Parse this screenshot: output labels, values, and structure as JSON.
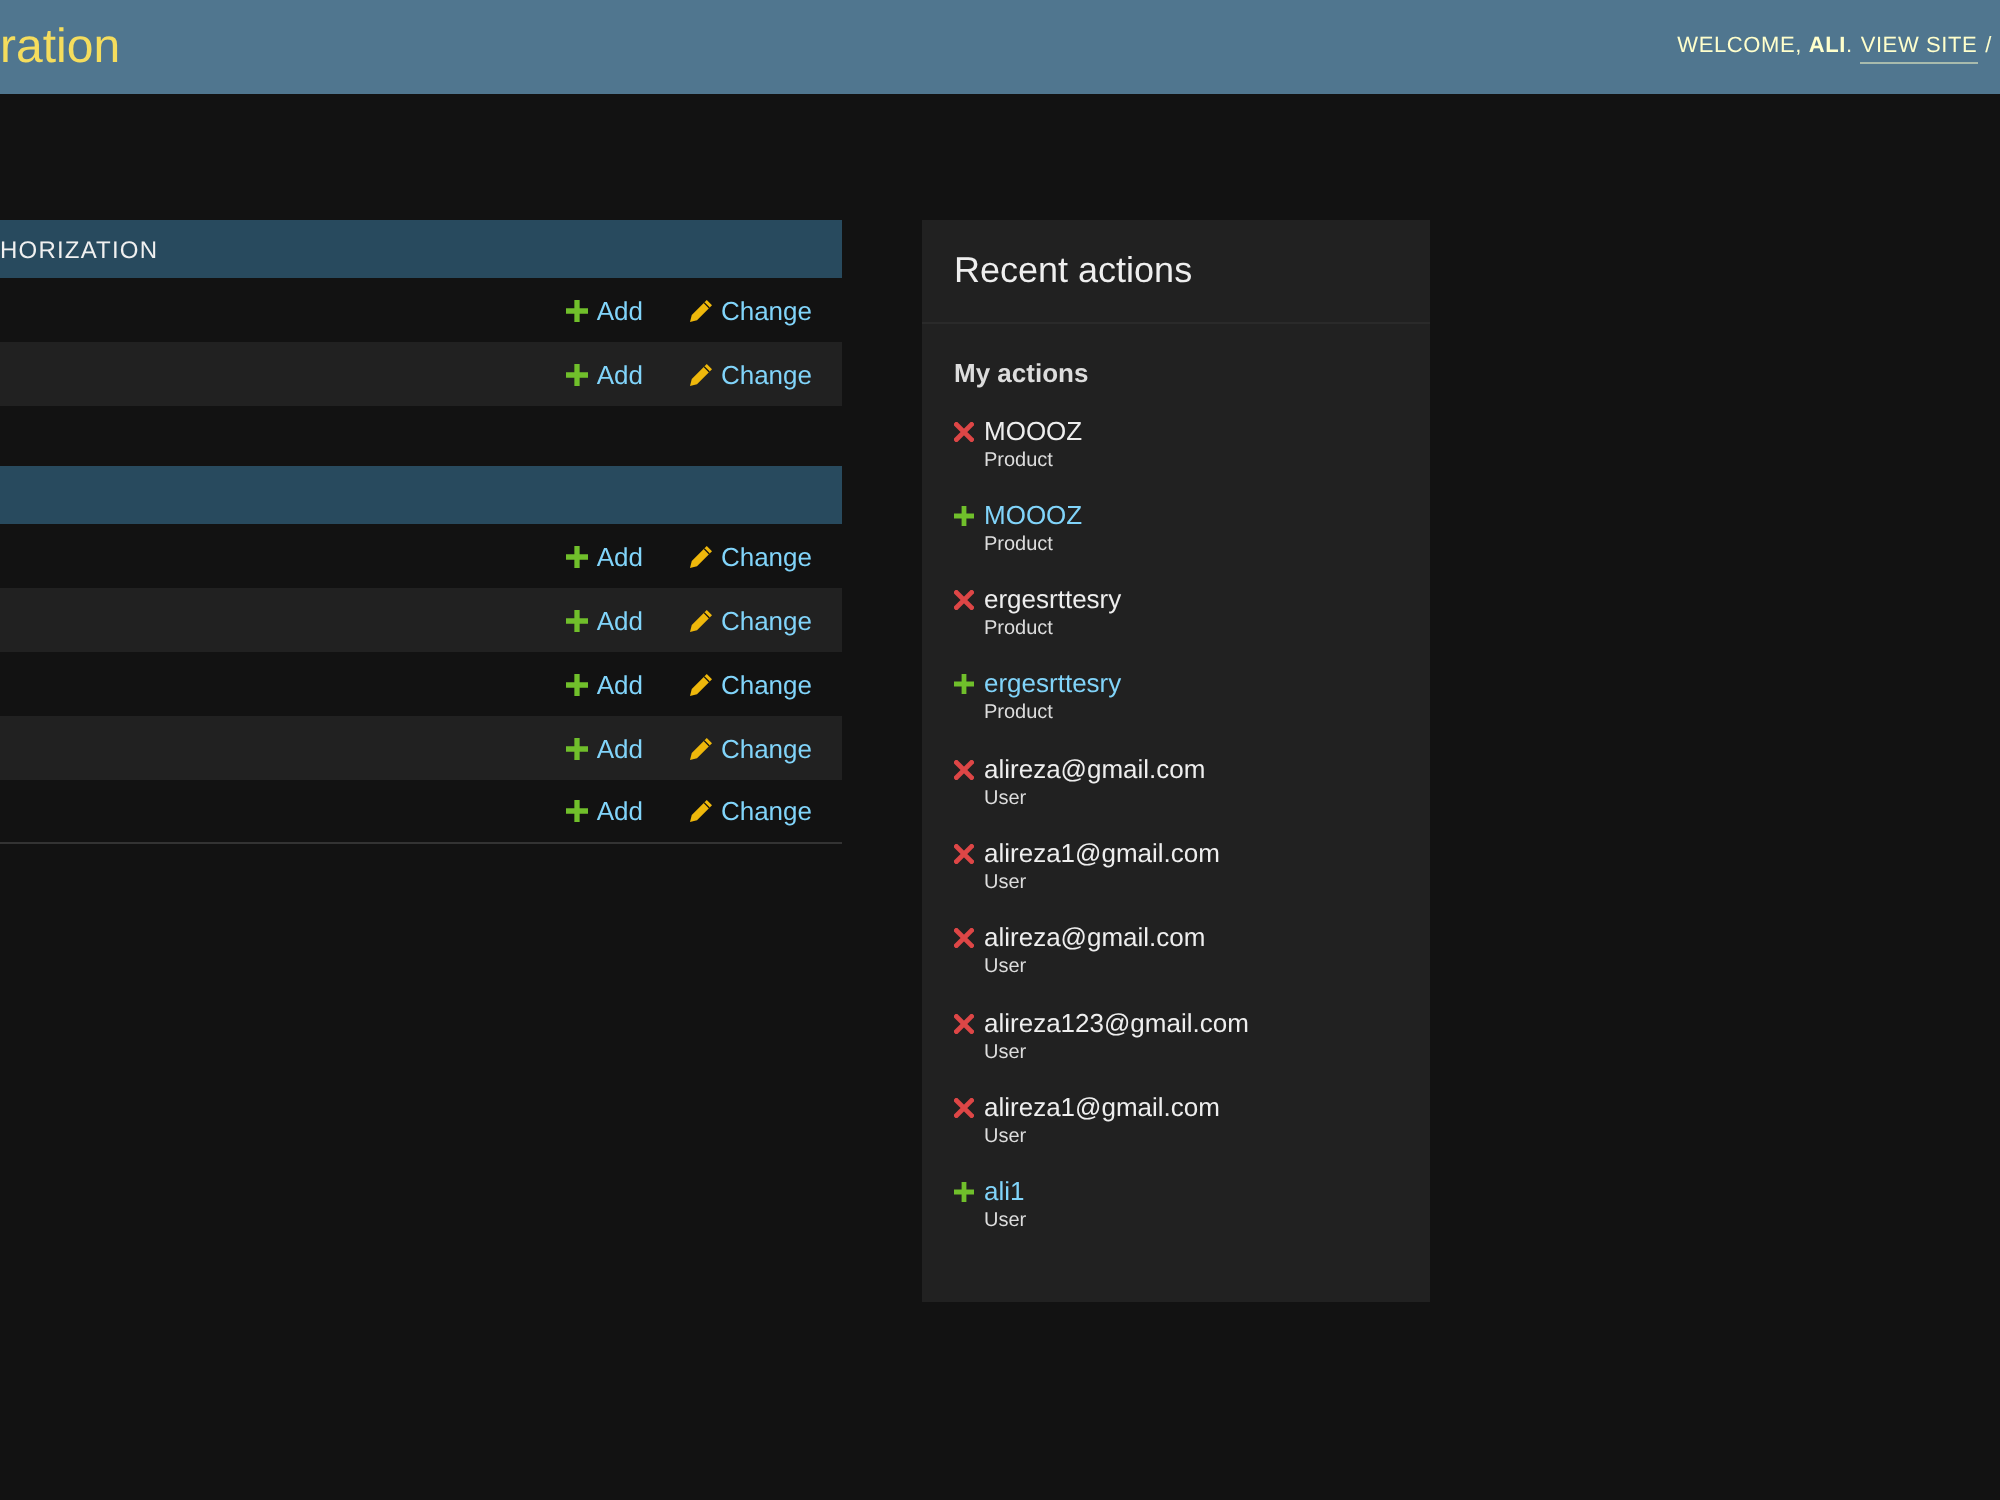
{
  "header": {
    "title": "ration",
    "welcome": "WELCOME, **ALI**.",
    "view_site": "VIEW SITE",
    "separator": "/"
  },
  "modules": [
    {
      "caption": "HORIZATION",
      "rows": [
        {
          "add": "Add",
          "change": "Change"
        },
        {
          "add": "Add",
          "change": "Change"
        }
      ]
    },
    {
      "rows": [
        {
          "add": "Add",
          "change": "Change"
        },
        {
          "add": "Add",
          "change": "Change"
        },
        {
          "add": "Add",
          "change": "Change"
        },
        {
          "add": "Add",
          "change": "Change"
        },
        {
          "add": "Add",
          "change": "Change"
        }
      ]
    }
  ],
  "recent_actions": {
    "title": "Recent actions",
    "subtitle": "My actions",
    "items": [
      {
        "kind": "deletion",
        "name": "MOOOZ",
        "type": "Product"
      },
      {
        "kind": "addition",
        "name": "MOOOZ",
        "type": "Product"
      },
      {
        "kind": "deletion",
        "name": "ergesrttesry",
        "type": "Product"
      },
      {
        "kind": "addition",
        "name": "ergesrttesry",
        "type": "Product"
      },
      {
        "kind": "deletion",
        "name": "alireza@gmail.com",
        "type": "User"
      },
      {
        "kind": "deletion",
        "name": "alireza1@gmail.com",
        "type": "User"
      },
      {
        "kind": "deletion",
        "name": "alireza@gmail.com",
        "type": "User"
      },
      {
        "kind": "deletion",
        "name": "alireza123@gmail.com",
        "type": "User"
      },
      {
        "kind": "deletion",
        "name": "alireza1@gmail.com",
        "type": "User"
      },
      {
        "kind": "addition",
        "name": "ali1",
        "type": "User"
      }
    ]
  }
}
